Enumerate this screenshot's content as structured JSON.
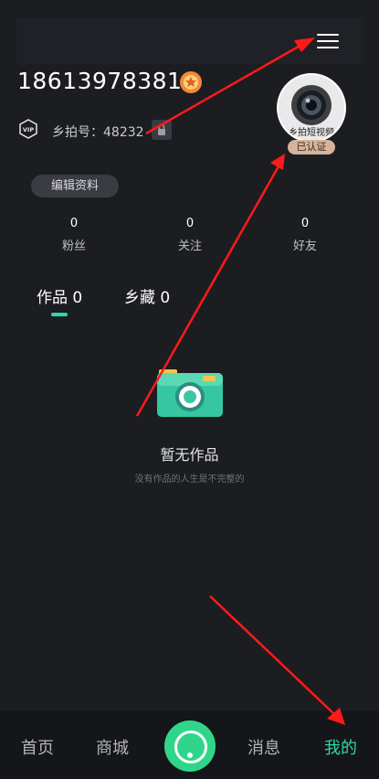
{
  "profile": {
    "phone": "18613978381",
    "id_label": "乡拍号：48232",
    "avatar_caption": "乡拍短视频",
    "verified_badge": "已认证",
    "edit_button": "编辑资料"
  },
  "stats": [
    {
      "count": "0",
      "label": "粉丝"
    },
    {
      "count": "0",
      "label": "关注"
    },
    {
      "count": "0",
      "label": "好友"
    }
  ],
  "tabs": [
    {
      "label": "作品 0",
      "active": true
    },
    {
      "label": "乡藏 0",
      "active": false
    }
  ],
  "empty_state": {
    "title": "暂无作品",
    "subtitle": "没有作品的人生是不完整的"
  },
  "bottom_nav": {
    "items": [
      {
        "label": "首页",
        "active": false
      },
      {
        "label": "商城",
        "active": false
      },
      {
        "label": "消息",
        "active": false
      },
      {
        "label": "我的",
        "active": true
      }
    ]
  },
  "icons": {
    "menu": "hamburger-menu-icon",
    "medal": "medal-icon",
    "vip": "vip-badge-icon",
    "lock": "lock-icon",
    "camera": "camera-illustration-icon",
    "record": "record-icon"
  },
  "colors": {
    "background": "#1c1d21",
    "accent": "#2fd6a2",
    "annotation": "#ff1a1a",
    "verified_badge": "#d6b39b"
  }
}
